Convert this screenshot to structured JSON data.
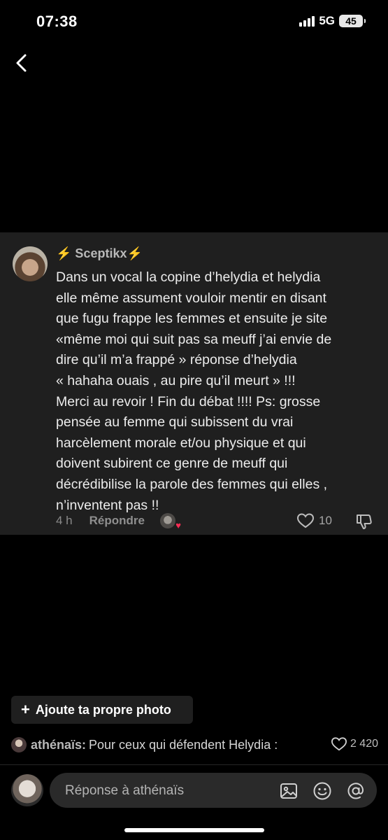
{
  "status_bar": {
    "time": "07:38",
    "network": "5G",
    "battery": "45"
  },
  "comment": {
    "author_prefix": "⚡️ ",
    "author": "Sceptikx",
    "author_suffix": "⚡️",
    "lines": [
      "Dans un vocal la copine d’helydia et helydia",
      "elle même assument vouloir mentir en disant",
      "que fugu frappe les femmes et ensuite je site",
      "«même moi qui suit pas sa meuff j’ai envie de",
      "dire qu’il m’a frappé » réponse d’helydia",
      "« hahaha ouais , au pire qu’il meurt » !!!",
      "Merci au revoir ! Fin du débat !!!! Ps: grosse",
      "pensée au femme qui subissent du vrai",
      "harcèlement morale et/ou physique et qui",
      "doivent subirent ce genre de meuff qui",
      "décrédibilise la parole des femmes qui elles ,",
      "n’inventent pas !!"
    ],
    "time_ago": "4 h",
    "reply_label": "Répondre",
    "like_count": "10"
  },
  "add_photo_label": "Ajoute ta propre photo",
  "reply_context": {
    "name": "athénaïs:",
    "text": "Pour ceux qui défendent Helydia :",
    "likes": "2 420"
  },
  "composer": {
    "placeholder": "Réponse à athénaïs"
  },
  "colors": {
    "background": "#000000",
    "card": "#1f1f1f",
    "heart_accent": "#ff2d55",
    "bolt": "#f5c518"
  },
  "icons": [
    "chevron-left-icon",
    "heart-icon",
    "thumbs-down-icon",
    "image-icon",
    "emoji-icon",
    "at-sign-icon"
  ]
}
